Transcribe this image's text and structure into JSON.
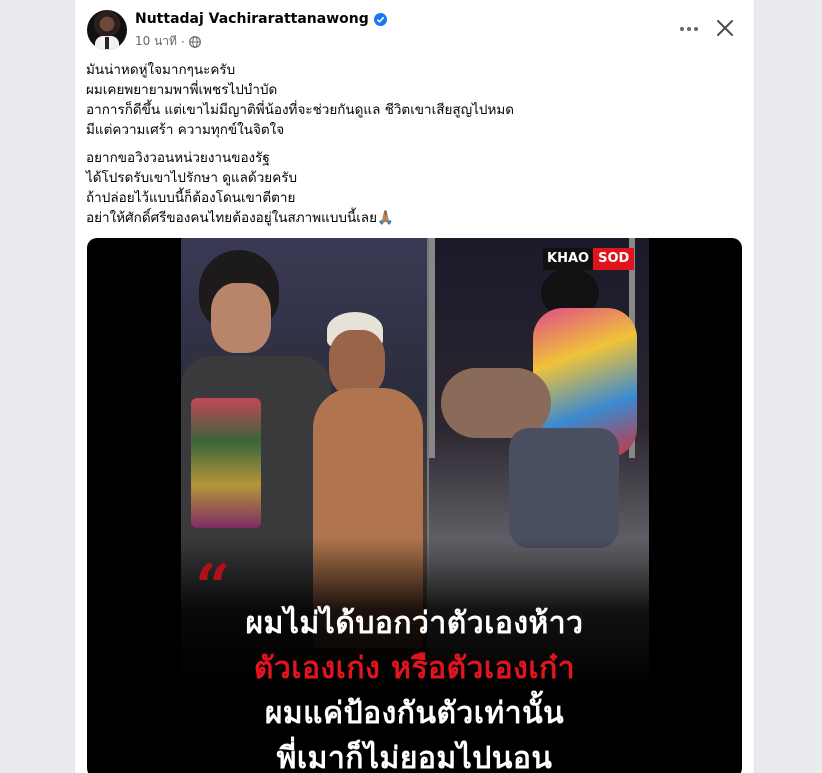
{
  "author": {
    "name": "Nuttadaj Vachirarattanawong",
    "verified": true
  },
  "meta": {
    "time": "10 นาที",
    "separator": "·",
    "audience_icon": "globe-icon"
  },
  "actions": {
    "more_icon": "more-horizontal-icon",
    "close_icon": "close-icon"
  },
  "post": {
    "para1": [
      "มันน่าหดหู่ใจมากๆนะครับ",
      "ผมเคยพยายามพาพี่เพชรไปบำบัด",
      "อาการก็ดีขึ้น แต่เขาไม่มีญาติพี่น้องที่จะช่วยกันดูแล ชีวิตเขาเสียสูญไปหมด",
      "มีแต่ความเศร้า ความทุกข์ในจิตใจ"
    ],
    "para2": [
      "อยากขอวิงวอนหน่วยงานของรัฐ",
      "ได้โปรดรับเขาไปรักษา ดูแลด้วยครับ",
      "ถ้าปล่อยไว้แบบนี้ก็ต้องโดนเขาตีตาย",
      "อย่าให้ศักดิ์ศรีของคนไทยต้องอยู่ในสภาพแบบนี้เลย🙏🏽"
    ]
  },
  "video": {
    "logo_left": "KHAO",
    "logo_right": "SOD",
    "caption": [
      "ผมไม่ได้บอกว่าตัวเองห้าว",
      "ตัวเองเก่ง หรือตัวเองเก๋า",
      "ผมแค่ป้องกันตัวเท่านั้น",
      "พี่เมาก็ไม่ยอมไปนอน"
    ]
  }
}
